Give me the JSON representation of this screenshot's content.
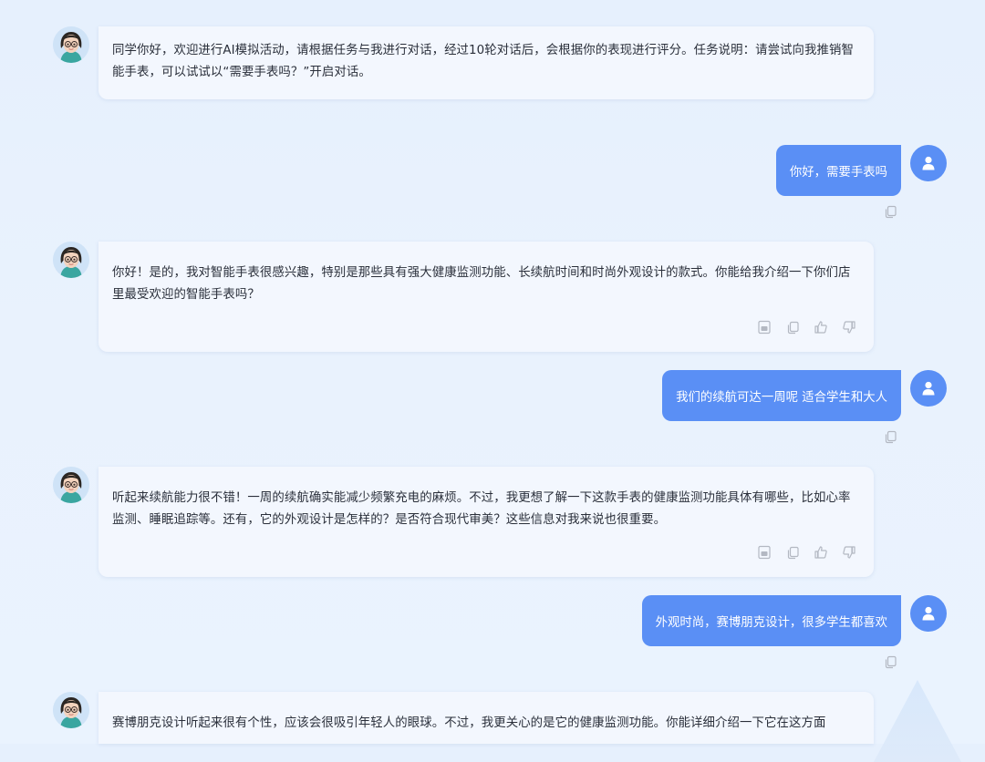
{
  "conversation": {
    "messages": [
      {
        "role": "ai",
        "text": "同学你好，欢迎进行AI模拟活动，请根据任务与我进行对话，经过10轮对话后，会根据你的表现进行评分。任务说明：请尝试向我推销智能手表，可以试试以“需要手表吗？”开启对话。"
      },
      {
        "role": "user",
        "text": "你好，需要手表吗"
      },
      {
        "role": "ai",
        "text": "你好！是的，我对智能手表很感兴趣，特别是那些具有强大健康监测功能、长续航时间和时尚外观设计的款式。你能给我介绍一下你们店里最受欢迎的智能手表吗？"
      },
      {
        "role": "user",
        "text": "我们的续航可达一周呢 适合学生和大人"
      },
      {
        "role": "ai",
        "text": "听起来续航能力很不错！一周的续航确实能减少频繁充电的麻烦。不过，我更想了解一下这款手表的健康监测功能具体有哪些，比如心率监测、睡眠追踪等。还有，它的外观设计是怎样的？是否符合现代审美？这些信息对我来说也很重要。"
      },
      {
        "role": "user",
        "text": "外观时尚，赛博朋克设计，很多学生都喜欢"
      },
      {
        "role": "ai",
        "text": "赛博朋克设计听起来很有个性，应该会很吸引年轻人的眼球。不过，我更关心的是它的健康监测功能。你能详细介绍一下它在这方面"
      }
    ]
  },
  "icons": {
    "ai_avatar": "girl-avatar-icon",
    "user_avatar": "user-person-icon",
    "ai_actions": [
      "read-aloud-icon",
      "copy-icon",
      "thumbs-up-icon",
      "thumbs-down-icon"
    ],
    "user_actions": [
      "copy-icon"
    ]
  },
  "colors": {
    "accent": "#5a8ff5",
    "ai_bubble": "#f3f7fe",
    "action_icon": "#b3b8c2"
  }
}
